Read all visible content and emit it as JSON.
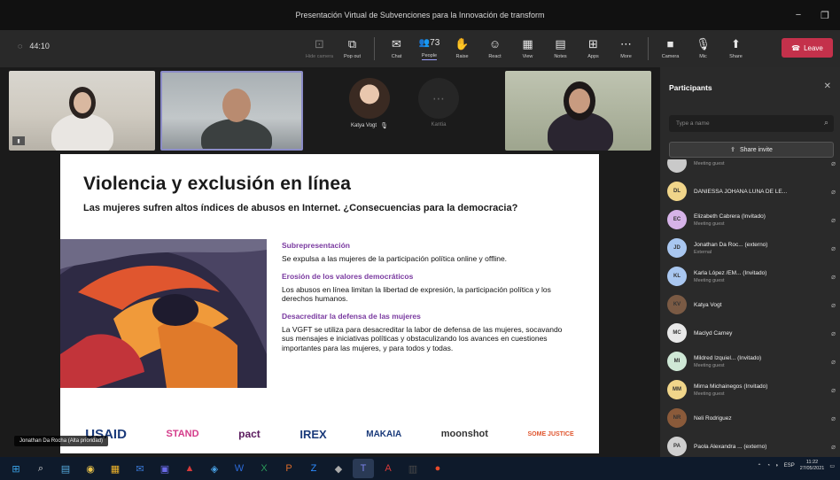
{
  "window": {
    "title": "Presentación Virtual de Subvenciones para la Innovación de transform",
    "controls": [
      "−",
      "❐",
      "✕"
    ]
  },
  "toolbar": {
    "timer": "44:10",
    "items": [
      {
        "icon": "camera-toggle-icon",
        "glyph": "⊡",
        "label": "Hide camera",
        "dim": true
      },
      {
        "icon": "pop-out-icon",
        "glyph": "⧉",
        "label": "Pop out",
        "dim": false
      },
      {
        "icon": "chat-icon",
        "glyph": "✉",
        "label": "Chat",
        "dim": false
      },
      {
        "icon": "people-icon",
        "glyph": "👥",
        "label": "People",
        "badge": "73",
        "active": true
      },
      {
        "icon": "raise-hand-icon",
        "glyph": "✋",
        "label": "Raise",
        "dim": false
      },
      {
        "icon": "react-icon",
        "glyph": "☺",
        "label": "React",
        "dim": false
      },
      {
        "icon": "view-icon",
        "glyph": "▦",
        "label": "View",
        "dim": false
      },
      {
        "icon": "notes-icon",
        "glyph": "▤",
        "label": "Notes",
        "dim": false
      },
      {
        "icon": "apps-icon",
        "glyph": "⊞",
        "label": "Apps",
        "dim": false
      },
      {
        "icon": "more-icon",
        "glyph": "⋯",
        "label": "More",
        "dim": false
      },
      {
        "icon": "camera-icon",
        "glyph": "■",
        "label": "Camera",
        "dim": false
      },
      {
        "icon": "mic-icon",
        "glyph": "🎙",
        "label": "Mic",
        "dim": false
      },
      {
        "icon": "share-icon",
        "glyph": "⬆",
        "label": "Share",
        "dim": false
      }
    ],
    "leave_label": "Leave"
  },
  "stage": {
    "avatar_name": "Katya Vogt",
    "empty_tile": "Kantia",
    "caption": "Jonathan Da Rocha (Alta prioridad)"
  },
  "slide": {
    "title": "Violencia y exclusión en línea",
    "subtitle": "Las mujeres sufren altos índices de abusos en Internet. ¿Consecuencias para la democracia?",
    "points": [
      {
        "heading": "Subrepresentación",
        "text": "Se expulsa a las mujeres de la participación política online y offline."
      },
      {
        "heading": "Erosión de los valores democráticos",
        "text": "Los abusos en línea limitan la libertad de expresión, la participación política y los derechos humanos."
      },
      {
        "heading": "Desacreditar la defensa de las mujeres",
        "text": "La VGFT se utiliza para desacreditar la labor de defensa de las mujeres, socavando sus mensajes e iniciativas políticas y obstaculizando los avances en cuestiones importantes para las mujeres, y para todos y todas."
      }
    ],
    "logos": [
      "USAID",
      "STAND",
      "pact",
      "IREX",
      "MAKAIA",
      "moonshot",
      "SOME JUSTICE"
    ]
  },
  "panel": {
    "title": "Participants",
    "search_placeholder": "Type a name",
    "share_label": "Share invite",
    "participants": [
      {
        "initials": "",
        "name": "",
        "role": "Meeting guest",
        "color": "#c9c9c9"
      },
      {
        "initials": "DL",
        "name": "DANIESSA JOHANA LUNA DE LE...",
        "role": "",
        "color": "#f0d58a"
      },
      {
        "initials": "EC",
        "name": "Elizabeth Cabrera (Invitado)",
        "role": "Meeting guest",
        "color": "#d6b3e8"
      },
      {
        "initials": "JD",
        "name": "Jonathan Da Roc... (externo)",
        "role": "External",
        "color": "#a9c7f0"
      },
      {
        "initials": "KL",
        "name": "Karla López /EM... (Invitado)",
        "role": "Meeting guest",
        "color": "#a9c7f0"
      },
      {
        "initials": "KV",
        "name": "Katya Vogt",
        "role": "",
        "color": "#7a5a44"
      },
      {
        "initials": "MC",
        "name": "Maclyd Carney",
        "role": "",
        "color": "#e8e8e8"
      },
      {
        "initials": "MI",
        "name": "Mildred Izquiel... (Invitado)",
        "role": "Meeting guest",
        "color": "#cfe8d6"
      },
      {
        "initials": "MM",
        "name": "Mirna Michainegos (Invitado)",
        "role": "Meeting guest",
        "color": "#f0d58a"
      },
      {
        "initials": "NR",
        "name": "Neli Rodriguez",
        "role": "",
        "color": "#8a5a3a"
      },
      {
        "initials": "PA",
        "name": "Paola Alexandra ... (externo)",
        "role": "",
        "color": "#cfcfcf"
      }
    ]
  },
  "taskbar": {
    "icons": [
      "windows-icon",
      "search-icon",
      "widgets-icon",
      "chrome-icon",
      "files-icon",
      "mail-icon",
      "teams-icon",
      "acrobat-icon",
      "store-icon",
      "word-icon",
      "excel-icon",
      "powerpoint-icon",
      "zoom-icon",
      "app-icon",
      "teams-active-icon",
      "acrobat-red-icon",
      "calculator-icon",
      "camera-app-icon"
    ],
    "lang": "ESP",
    "time": "11:22",
    "date": "27/05/2021"
  }
}
